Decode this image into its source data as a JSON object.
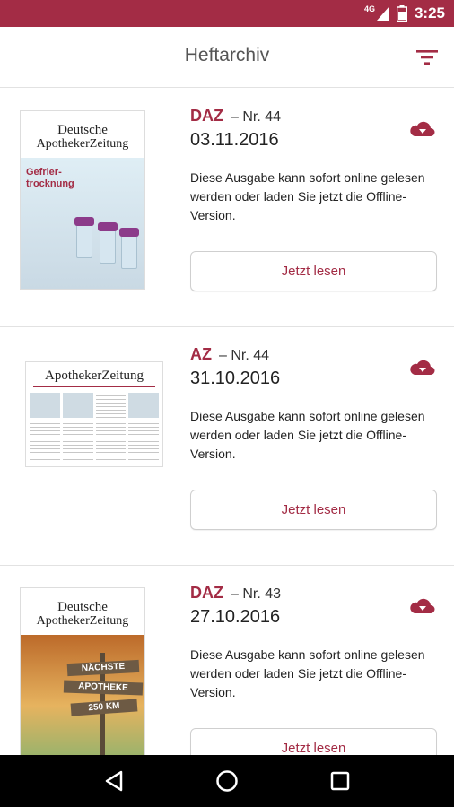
{
  "status_bar": {
    "time": "3:25",
    "network": "4G",
    "bg_color": "#a32c45"
  },
  "app_bar": {
    "title": "Heftarchiv",
    "filter_icon": "filter-list-icon"
  },
  "accent_color": "#a32c45",
  "issues": [
    {
      "brand": "DAZ",
      "issue_number": "– Nr. 44",
      "date": "03.11.2016",
      "description": "Diese Ausgabe kann sofort online gelesen werden oder laden Sie jetzt die Offline-Version.",
      "button_label": "Jetzt lesen",
      "download_icon": "cloud-download-icon",
      "cover": {
        "masthead_line1": "Deutsche",
        "masthead_line2": "ApothekerZeitung",
        "headline": "Gefrier-\ntrocknung"
      }
    },
    {
      "brand": "AZ",
      "issue_number": "– Nr. 44",
      "date": "31.10.2016",
      "description": "Diese Ausgabe kann sofort online gelesen werden oder laden Sie jetzt die Offline-Version.",
      "button_label": "Jetzt lesen",
      "download_icon": "cloud-download-icon",
      "cover": {
        "masthead_line1": "ApothekerZeitung"
      }
    },
    {
      "brand": "DAZ",
      "issue_number": "– Nr. 43",
      "date": "27.10.2016",
      "description": "Diese Ausgabe kann sofort online gelesen werden oder laden Sie jetzt die Offline-Version.",
      "button_label": "Jetzt lesen",
      "download_icon": "cloud-download-icon",
      "cover": {
        "masthead_line1": "Deutsche",
        "masthead_line2": "ApothekerZeitung",
        "sign_1": "NÄCHSTE",
        "sign_2": "APOTHEKE",
        "sign_3": "250 KM"
      }
    }
  ],
  "nav_bar": {
    "back_icon": "back-triangle-icon",
    "home_icon": "home-circle-icon",
    "recents_icon": "recents-square-icon"
  }
}
